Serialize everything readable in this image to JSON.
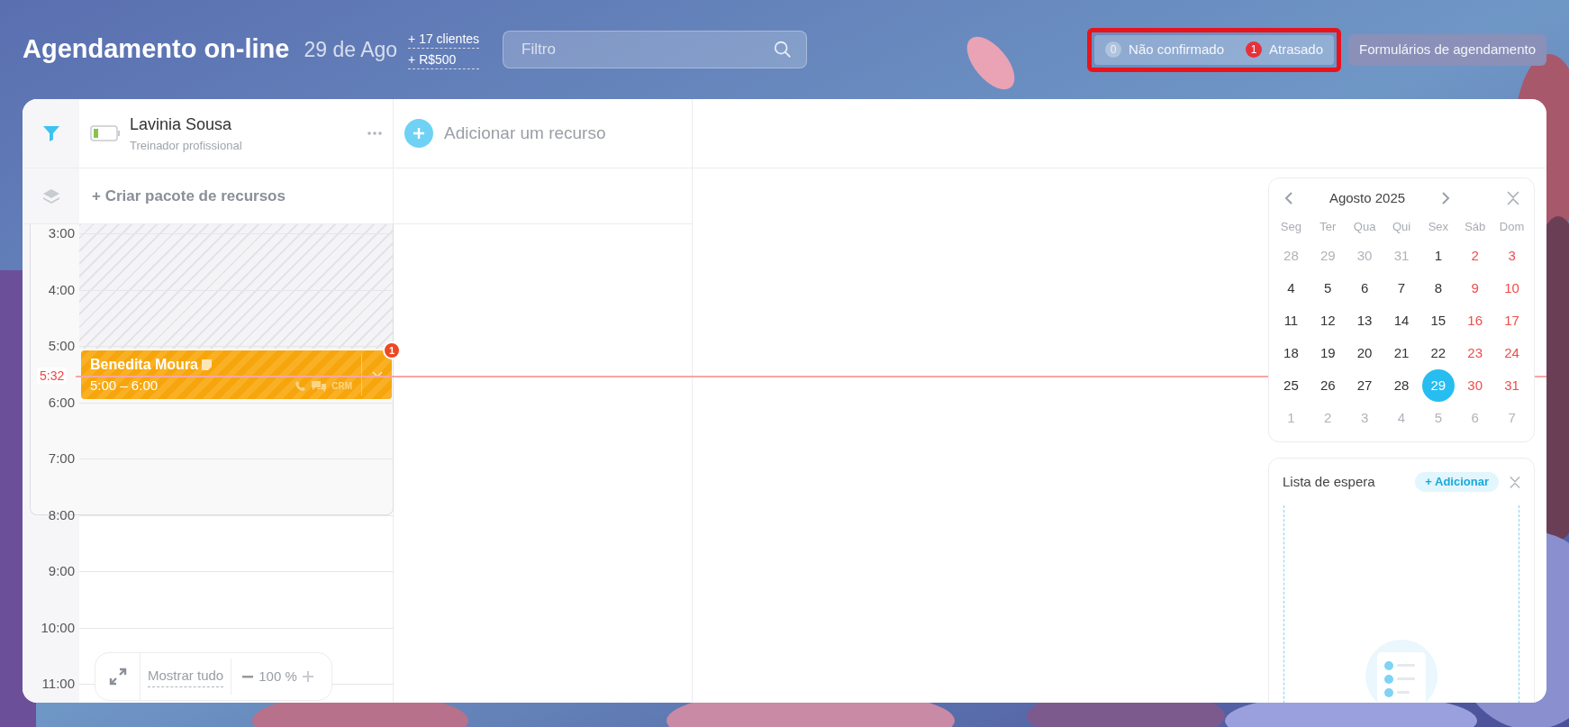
{
  "header": {
    "title": "Agendamento on-line",
    "date": "29 de Ago",
    "stats": [
      "+ 17 clientes",
      "+ R$500"
    ],
    "search": {
      "placeholder": "Filtro"
    },
    "status_filters": [
      {
        "count": "0",
        "label": "Não confirmado",
        "kind": "neutral"
      },
      {
        "count": "1",
        "label": "Atrasado",
        "kind": "alert"
      }
    ],
    "forms_button": "Formulários de agendamento"
  },
  "resources": [
    {
      "name": "Lavinia Sousa",
      "role": "Treinador profissional"
    }
  ],
  "add_resource": "Adicionar um recurso",
  "create_package": "+ Criar pacote de recursos",
  "timeline": {
    "hours": [
      "3:00",
      "4:00",
      "5:00",
      "6:00",
      "7:00",
      "8:00",
      "9:00",
      "10:00",
      "11:00"
    ],
    "now": "5:32"
  },
  "events": [
    {
      "client": "Benedita Moura",
      "time": "5:00 – 6:00",
      "badge": "1",
      "crm": "CRM"
    }
  ],
  "zoom": {
    "show_all": "Mostrar tudo",
    "value": "100 %"
  },
  "calendar": {
    "month": "Agosto 2025",
    "weekdays": [
      "Seg",
      "Ter",
      "Qua",
      "Qui",
      "Sex",
      "Sáb",
      "Dom"
    ],
    "weeks": [
      [
        {
          "day": "28",
          "kind": "other",
          "selected": false
        },
        {
          "day": "29",
          "kind": "other",
          "selected": false
        },
        {
          "day": "30",
          "kind": "other",
          "selected": false
        },
        {
          "day": "31",
          "kind": "other",
          "selected": false
        },
        {
          "day": "1",
          "kind": "weekday",
          "selected": false
        },
        {
          "day": "2",
          "kind": "weekend",
          "selected": false
        },
        {
          "day": "3",
          "kind": "weekend",
          "selected": false
        }
      ],
      [
        {
          "day": "4",
          "kind": "weekday",
          "selected": false
        },
        {
          "day": "5",
          "kind": "weekday",
          "selected": false
        },
        {
          "day": "6",
          "kind": "weekday",
          "selected": false
        },
        {
          "day": "7",
          "kind": "weekday",
          "selected": false
        },
        {
          "day": "8",
          "kind": "weekday",
          "selected": false
        },
        {
          "day": "9",
          "kind": "weekend",
          "selected": false
        },
        {
          "day": "10",
          "kind": "weekend",
          "selected": false
        }
      ],
      [
        {
          "day": "11",
          "kind": "weekday",
          "selected": false
        },
        {
          "day": "12",
          "kind": "weekday",
          "selected": false
        },
        {
          "day": "13",
          "kind": "weekday",
          "selected": false
        },
        {
          "day": "14",
          "kind": "weekday",
          "selected": false
        },
        {
          "day": "15",
          "kind": "weekday",
          "selected": false
        },
        {
          "day": "16",
          "kind": "weekend",
          "selected": false
        },
        {
          "day": "17",
          "kind": "weekend",
          "selected": false
        }
      ],
      [
        {
          "day": "18",
          "kind": "weekday",
          "selected": false
        },
        {
          "day": "19",
          "kind": "weekday",
          "selected": false
        },
        {
          "day": "20",
          "kind": "weekday",
          "selected": false
        },
        {
          "day": "21",
          "kind": "weekday",
          "selected": false
        },
        {
          "day": "22",
          "kind": "weekday",
          "selected": false
        },
        {
          "day": "23",
          "kind": "weekend",
          "selected": false
        },
        {
          "day": "24",
          "kind": "weekend",
          "selected": false
        }
      ],
      [
        {
          "day": "25",
          "kind": "weekday",
          "selected": false
        },
        {
          "day": "26",
          "kind": "weekday",
          "selected": false
        },
        {
          "day": "27",
          "kind": "weekday",
          "selected": false
        },
        {
          "day": "28",
          "kind": "weekday",
          "selected": false
        },
        {
          "day": "29",
          "kind": "weekday",
          "selected": true
        },
        {
          "day": "30",
          "kind": "weekend",
          "selected": false
        },
        {
          "day": "31",
          "kind": "weekend",
          "selected": false
        }
      ],
      [
        {
          "day": "1",
          "kind": "other",
          "selected": false
        },
        {
          "day": "2",
          "kind": "other",
          "selected": false
        },
        {
          "day": "3",
          "kind": "other",
          "selected": false
        },
        {
          "day": "4",
          "kind": "other",
          "selected": false
        },
        {
          "day": "5",
          "kind": "other",
          "selected": false
        },
        {
          "day": "6",
          "kind": "other",
          "selected": false
        },
        {
          "day": "7",
          "kind": "other",
          "selected": false
        }
      ]
    ]
  },
  "waitlist": {
    "title": "Lista de espera",
    "add_button": "+ Adicionar"
  }
}
